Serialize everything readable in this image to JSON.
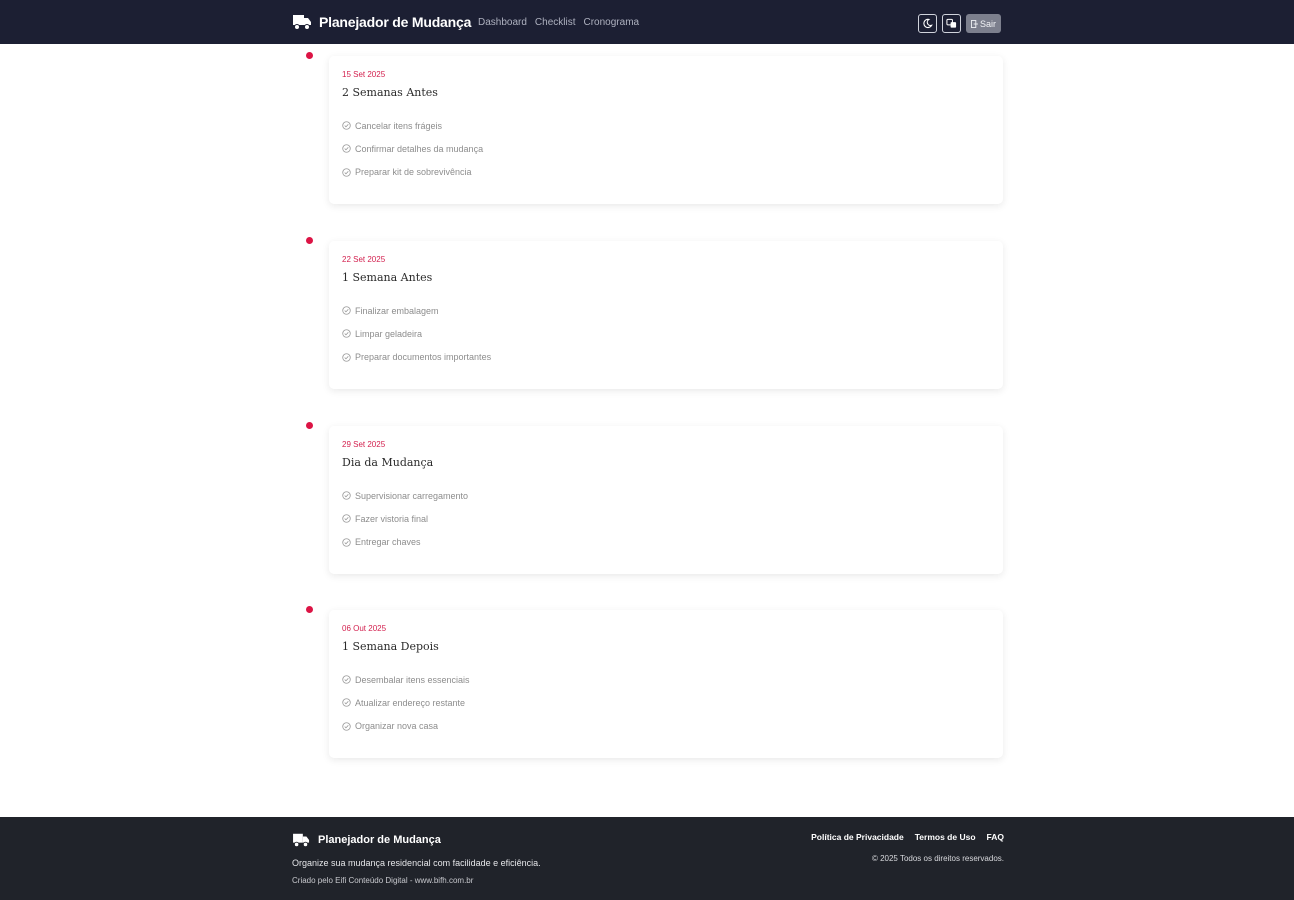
{
  "header": {
    "brand": "Planejador de Mudança",
    "nav": [
      "Dashboard",
      "Checklist",
      "Cronograma"
    ],
    "logout_label": "Sair"
  },
  "timeline": [
    {
      "date": "15 Set 2025",
      "title": "2 Semanas Antes",
      "tasks": [
        "Cancelar itens frágeis",
        "Confirmar detalhes da mudança",
        "Preparar kit de sobrevivência"
      ]
    },
    {
      "date": "22 Set 2025",
      "title": "1 Semana Antes",
      "tasks": [
        "Finalizar embalagem",
        "Limpar geladeira",
        "Preparar documentos importantes"
      ]
    },
    {
      "date": "29 Set 2025",
      "title": "Dia da Mudança",
      "tasks": [
        "Supervisionar carregamento",
        "Fazer vistoria final",
        "Entregar chaves"
      ]
    },
    {
      "date": "06 Out 2025",
      "title": "1 Semana Depois",
      "tasks": [
        "Desembalar itens essenciais",
        "Atualizar endereço restante",
        "Organizar nova casa"
      ]
    }
  ],
  "footer": {
    "brand": "Planejador de Mudança",
    "description": "Organize sua mudança residencial com facilidade e eficiência.",
    "credit": "Criado pelo Eifi Conteúdo Digital - www.bifh.com.br",
    "links": [
      "Política de Privacidade",
      "Termos de Uso",
      "FAQ"
    ],
    "copyright": "© 2025 Todos os direitos reservados."
  },
  "colors": {
    "navbar": "#1c1f33",
    "accent": "#dc1445",
    "footer": "#20232a"
  },
  "icons": {
    "brand": "moving-truck-icon",
    "task": "check-circle-icon",
    "theme_toggle": "moon-icon",
    "translate": "translate-icon",
    "logout": "logout-icon"
  }
}
